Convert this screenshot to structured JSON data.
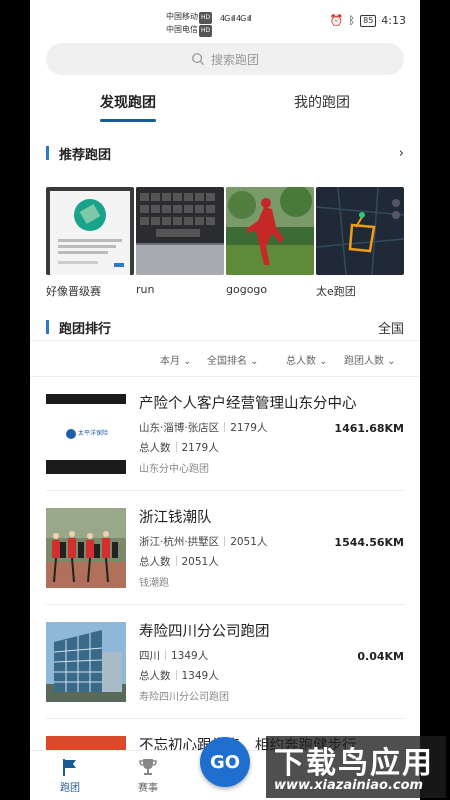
{
  "status_bar": {
    "carrier1": "中国移动",
    "carrier2": "中国电信",
    "hd": "HD",
    "signal": "4G ıll 4G ıll",
    "battery": "85",
    "time": "4:13"
  },
  "search": {
    "placeholder": "搜索跑团"
  },
  "tabs": {
    "discover": "发现跑团",
    "mine": "我的跑团"
  },
  "recommended": {
    "title": "推荐跑团",
    "items": [
      {
        "label": "好像晋级赛"
      },
      {
        "label": "run"
      },
      {
        "label": "gogogo"
      },
      {
        "label": "太e跑团"
      }
    ]
  },
  "ranking": {
    "title": "跑团排行",
    "scope": "全国",
    "filters": [
      "本月",
      "全国排名",
      "总人数",
      "跑团人数"
    ]
  },
  "clubs": [
    {
      "name": "产险个人客户经营管理山东分中心",
      "region": "山东·淄博·张店区",
      "members": "2179人",
      "total_label": "总人数",
      "total": "2179人",
      "team": "山东分中心跑团",
      "km": "1461.68KM",
      "logo_text": "太平洋保险"
    },
    {
      "name": "浙江钱潮队",
      "region": "浙江·杭州·拱墅区",
      "members": "2051人",
      "total_label": "总人数",
      "total": "2051人",
      "team": "钱潮跑",
      "km": "1544.56KM"
    },
    {
      "name": "寿险四川分公司跑团",
      "region": "四川",
      "members": "1349人",
      "total_label": "总人数",
      "total": "1349人",
      "team": "寿险四川分公司跑团",
      "km": "0.04KM"
    },
    {
      "name": "不忘初心跟党走，相约奔跑健步行"
    }
  ],
  "bottom_nav": {
    "club": "跑团",
    "events": "赛事",
    "go": "GO"
  },
  "watermark": {
    "main": "下载鸟应用",
    "url": "www.xiazainiao.com"
  },
  "colors": {
    "accent": "#1a5a93",
    "bar": "#2a7ac8",
    "go": "#1f6fd1"
  }
}
